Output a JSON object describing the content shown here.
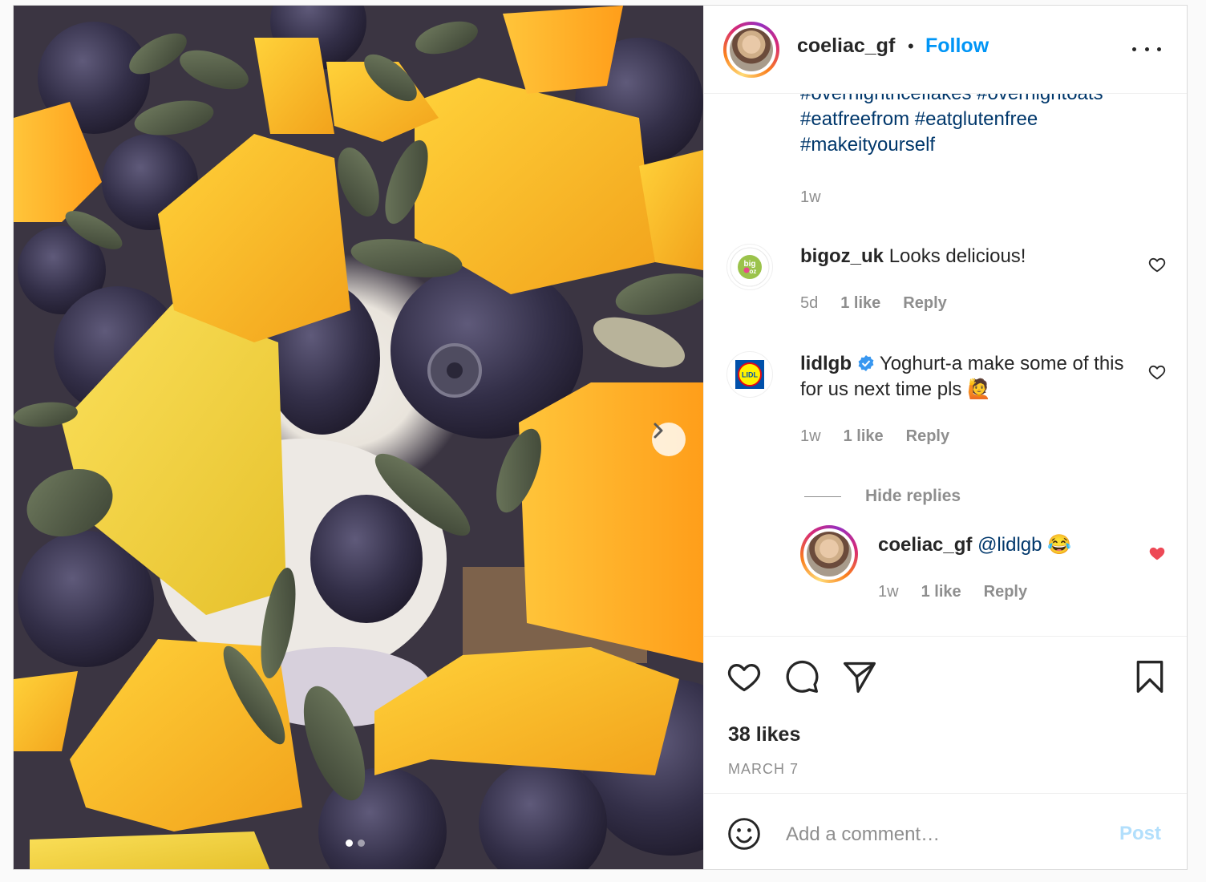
{
  "post": {
    "username": "coeliac_gf",
    "separator": "•",
    "follow_label": "Follow",
    "more_icon": "more-horizontal-icon",
    "image_alt": "Close-up of mango cubes, blueberries and pumpkin seeds on yoghurt",
    "carousel": {
      "count": 2,
      "active_index": 0
    }
  },
  "caption": {
    "hashtag_lines": [
      [
        "#overnightricefiakes",
        "#overnightoats"
      ],
      [
        "#eatfreefrom",
        "#eatglutenfree"
      ],
      [
        "#makeityourself"
      ]
    ],
    "time": "1w"
  },
  "comments": [
    {
      "username": "bigoz_uk",
      "text": "Looks delicious!",
      "time": "5d",
      "likes": "1 like",
      "reply": "Reply",
      "avatar_text": "big oz"
    },
    {
      "username": "lidlgb",
      "verified": true,
      "text": "Yoghurt-a make some of this for us next time pls 🙋",
      "time": "1w",
      "likes": "1 like",
      "reply": "Reply",
      "avatar_text": "LIDL"
    }
  ],
  "hide_replies_label": "Hide replies",
  "reply": {
    "username": "coeliac_gf",
    "mention": "@lidlgb",
    "emoji": "😂",
    "time": "1w",
    "likes": "1 like",
    "reply": "Reply",
    "liked": true
  },
  "actions": {
    "likes_text": "38 likes",
    "date": "MARCH 7"
  },
  "composer": {
    "placeholder": "Add a comment…",
    "post_label": "Post"
  },
  "colors": {
    "link_blue": "#0095f6",
    "hashtag_blue": "#00376b",
    "muted": "#8e8e8e",
    "post_disabled": "#b2dffc",
    "heart_red": "#ed4956"
  }
}
